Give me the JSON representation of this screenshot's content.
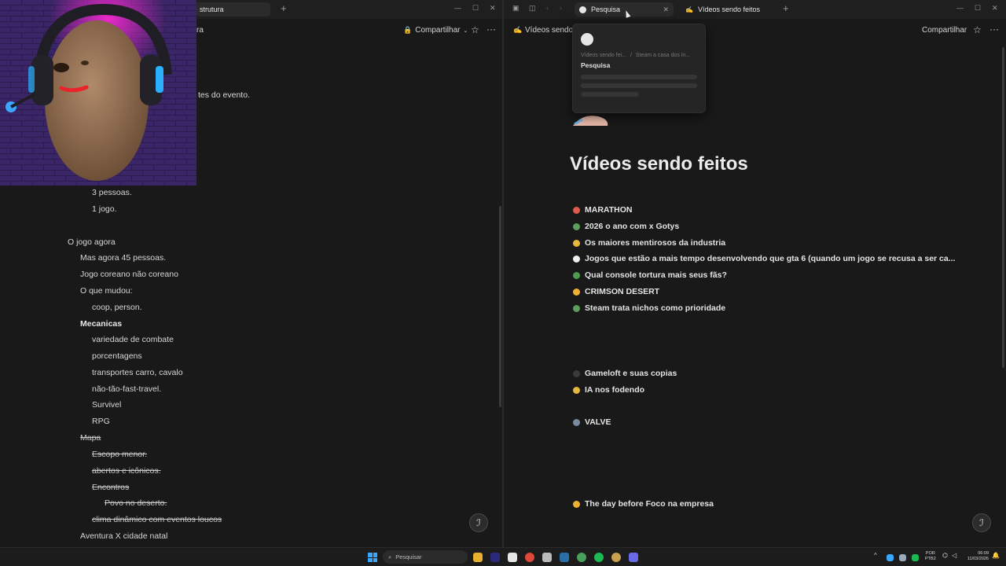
{
  "left": {
    "tab_title": "strutura",
    "breadcrumb_fragment": "ra",
    "share_label": "Compartilhar",
    "partial_line": "tes do evento.",
    "lines": [
      {
        "text": "3 pessoas.",
        "style": "normal"
      },
      {
        "text": "1 jogo.",
        "style": "normal"
      },
      {
        "text": "O jogo agora",
        "style": "normal"
      },
      {
        "text": "Mas agora 45 pessoas.",
        "style": "normal"
      },
      {
        "text": "Jogo coreano não coreano",
        "style": "normal"
      },
      {
        "text": "O que mudou:",
        "style": "normal"
      },
      {
        "text": "coop, person.",
        "style": "normal"
      },
      {
        "text": "Mecanicas",
        "style": "bold"
      },
      {
        "text": "variedade de combate",
        "style": "normal"
      },
      {
        "text": "porcentagens",
        "style": "normal"
      },
      {
        "text": "transportes carro, cavalo",
        "style": "normal"
      },
      {
        "text": "não-tão-fast-travel.",
        "style": "normal"
      },
      {
        "text": "Survivel",
        "style": "normal"
      },
      {
        "text": "RPG",
        "style": "normal"
      },
      {
        "text": "Mapa",
        "style": "strike"
      },
      {
        "text": "Escopo menor.",
        "style": "strike"
      },
      {
        "text": "abertos e icônicos.",
        "style": "strike"
      },
      {
        "text": "Encontros",
        "style": "strike"
      },
      {
        "text": "Povo no deserto.",
        "style": "strike"
      },
      {
        "text": "clima dinâmico com eventos loucos",
        "style": "strike"
      },
      {
        "text": "Aventura X cidade natal",
        "style": "normal"
      }
    ]
  },
  "right": {
    "tab_search": "Pesquisa",
    "tab_page": "Vídeos sendo feitos",
    "breadcrumb": "Vídeos sendo f",
    "share_label": "Compartilhar",
    "page_title": "Vídeos sendo feitos",
    "popup": {
      "path1": "Vídeos sendo fei...",
      "path2": "Steam a casa dos in...",
      "title": "Pesquisa"
    },
    "items": [
      {
        "text": "MARATHON",
        "color": "#e05a4a"
      },
      {
        "text": "2026 o ano com x Gotys",
        "color": "#5aa05a"
      },
      {
        "text": "Os maiores mentirosos da industria",
        "color": "#e8b63c"
      },
      {
        "text": "Jogos que estão a mais tempo desenvolvendo que gta 6 (quando um jogo se recusa a ser ca...",
        "color": "#eeeeee"
      },
      {
        "text": "Qual console tortura mais seus fãs?",
        "color": "#4f9a4f"
      },
      {
        "text": "CRIMSON DESERT",
        "color": "#f0b030"
      },
      {
        "text": "Steam trata nichos como prioridade",
        "color": "#5aa05a"
      },
      {
        "text": "Gameloft e suas copias",
        "color": "#3a3a3a"
      },
      {
        "text": "IA nos fodendo",
        "color": "#e8b63c"
      },
      {
        "text": "VALVE",
        "color": "#7a8aa0"
      },
      {
        "text": "The day before Foco na empresa",
        "color": "#f0b030"
      }
    ]
  },
  "taskbar": {
    "search_placeholder": "Pesquisar",
    "lang_top": "POR",
    "lang_bottom": "PTB2",
    "time": "06:09",
    "date": "11/03/2026"
  }
}
